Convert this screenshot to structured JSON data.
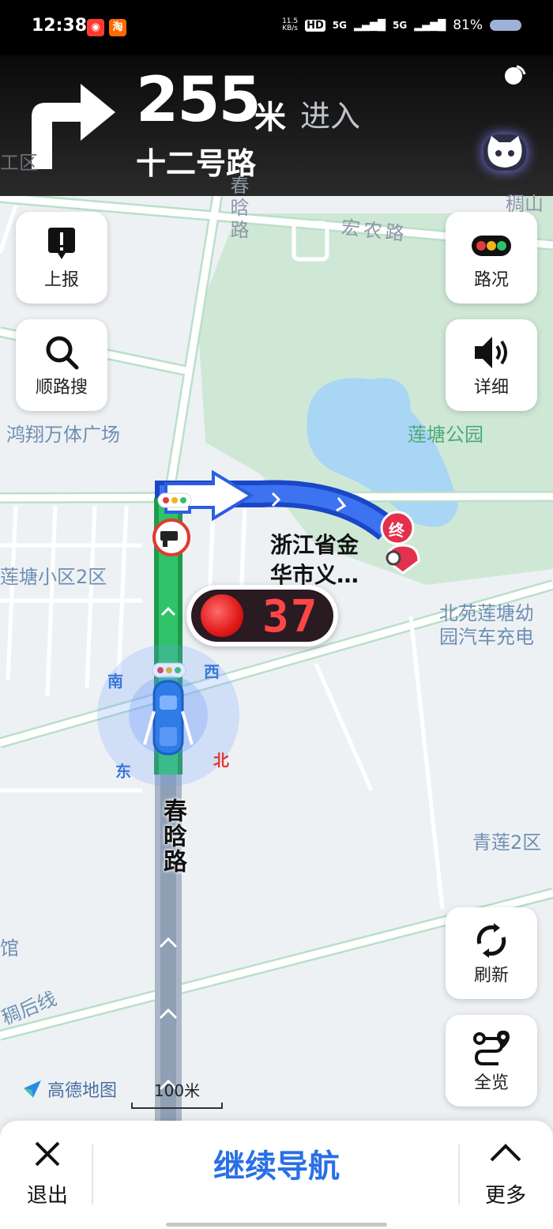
{
  "status_bar": {
    "time": "12:38",
    "net_speed_value": "11.5",
    "net_speed_unit": "KB/s",
    "hd": "HD",
    "sig1": "5G",
    "sig2": "5G",
    "battery": "81%"
  },
  "navigation": {
    "distance": "255",
    "unit": "米",
    "action": "进入",
    "road": "十二号路"
  },
  "buttons": {
    "report": "上报",
    "traffic": "路况",
    "search_along": "顺路搜",
    "detail": "详细",
    "refresh": "刷新",
    "overview": "全览"
  },
  "map": {
    "labels": {
      "chunhan_top": "春晗路",
      "hongnong": "宏农路",
      "tongshan": "稠山",
      "district": "工区",
      "hongxiang": "鸿翔万体广场",
      "liantang_park": "莲塘公园",
      "liantang_xiaoqu": "莲塘小区2区",
      "beiyuan": "北苑莲塘幼",
      "beiyuan2": "园汽车充电",
      "destination_1": "浙江省金",
      "destination_2": "华市义…",
      "chunhan_road": "春晗路",
      "qinglian": "青莲2区",
      "guan": "馆",
      "tonghou": "稠后线",
      "end_marker": "终"
    },
    "compass": {
      "south": "南",
      "west": "西",
      "east": "东",
      "north": "北"
    },
    "traffic_light_countdown": "37",
    "brand": "高德地图",
    "scale": "100米"
  },
  "bottom_bar": {
    "exit": "退出",
    "continue": "继续导航",
    "more": "更多"
  }
}
